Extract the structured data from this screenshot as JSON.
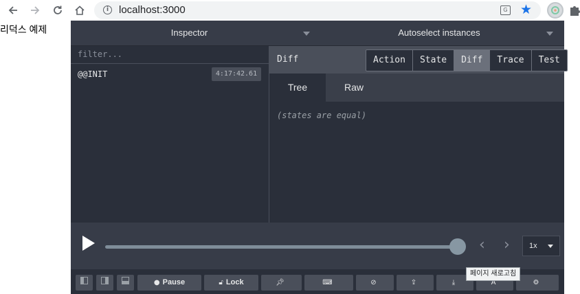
{
  "browser": {
    "url": "localhost:3000",
    "back_icon": "arrow-left-icon",
    "forward_icon": "arrow-right-icon",
    "reload_icon": "reload-icon",
    "home_icon": "home-icon",
    "info_icon": "info-icon",
    "translate_icon": "translate-icon",
    "bookmark_icon": "star-icon",
    "bookmark_color": "#1a73e8"
  },
  "page": {
    "text": "리덕스 예제"
  },
  "devtools": {
    "top_left_label": "Inspector",
    "top_right_label": "Autoselect instances",
    "filter": {
      "placeholder": "filter...",
      "value": ""
    },
    "actions": [
      {
        "name": "@@INIT",
        "time": "4:17:42.61"
      }
    ],
    "diff_title": "Diff",
    "modes": [
      {
        "label": "Action",
        "active": false
      },
      {
        "label": "State",
        "active": false
      },
      {
        "label": "Diff",
        "active": true
      },
      {
        "label": "Trace",
        "active": false
      },
      {
        "label": "Test",
        "active": false
      }
    ],
    "subtabs": [
      {
        "label": "Tree",
        "active": true
      },
      {
        "label": "Raw",
        "active": false
      }
    ],
    "diff_message": "(states are equal)",
    "slider": {
      "position": 1.0,
      "speed": "1x"
    },
    "bottom_buttons": {
      "pause": "Pause",
      "lock": "Lock"
    },
    "tooltip": "페이지 새로고침",
    "colors": {
      "panel_bg": "#2a2f3a",
      "bar_bg": "#373c48",
      "button_bg": "#4a4f5a",
      "active_mode": "#6b707b"
    }
  }
}
